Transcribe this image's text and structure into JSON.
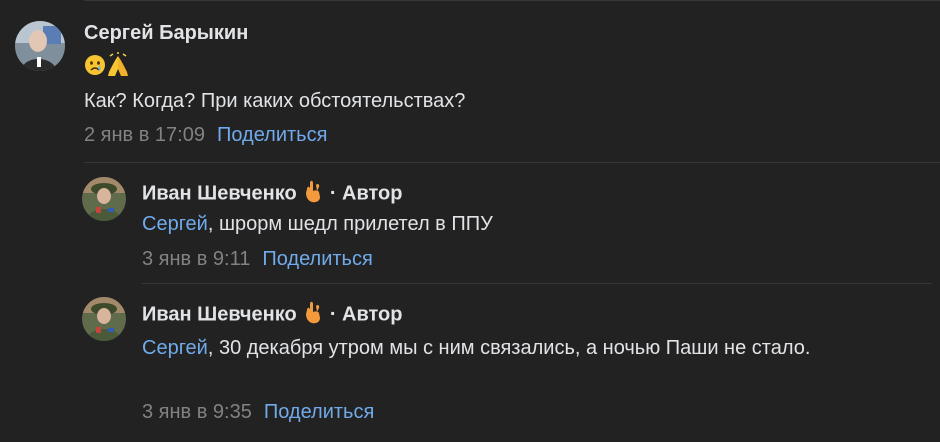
{
  "comments": [
    {
      "author": "Сергей Барыкин",
      "emoji_line": [
        "crying-face-icon",
        "praying-hands-icon"
      ],
      "text": "Как? Когда? При каких обстоятельствах?",
      "date": "2 янв в 17:09",
      "share_label": "Поделиться"
    },
    {
      "author": "Иван Шевченко",
      "author_badge_icon": "call-me-hand-icon",
      "author_tag": "· Автор",
      "mention": "Сергей",
      "text": ", шрорм шедл прилетел в ППУ",
      "date": "3 янв в 9:11",
      "share_label": "Поделиться"
    },
    {
      "author": "Иван Шевченко",
      "author_badge_icon": "call-me-hand-icon",
      "author_tag": "· Автор",
      "mention": "Сергей",
      "text": ", 30 декабря утром мы с ним связались, а ночью Паши не стало.",
      "date": "3 янв в 9:35",
      "share_label": "Поделиться"
    }
  ],
  "colors": {
    "background": "#222222",
    "text": "#e1e3e6",
    "link": "#71aaeb",
    "meta": "#828282",
    "divider": "#363738"
  }
}
